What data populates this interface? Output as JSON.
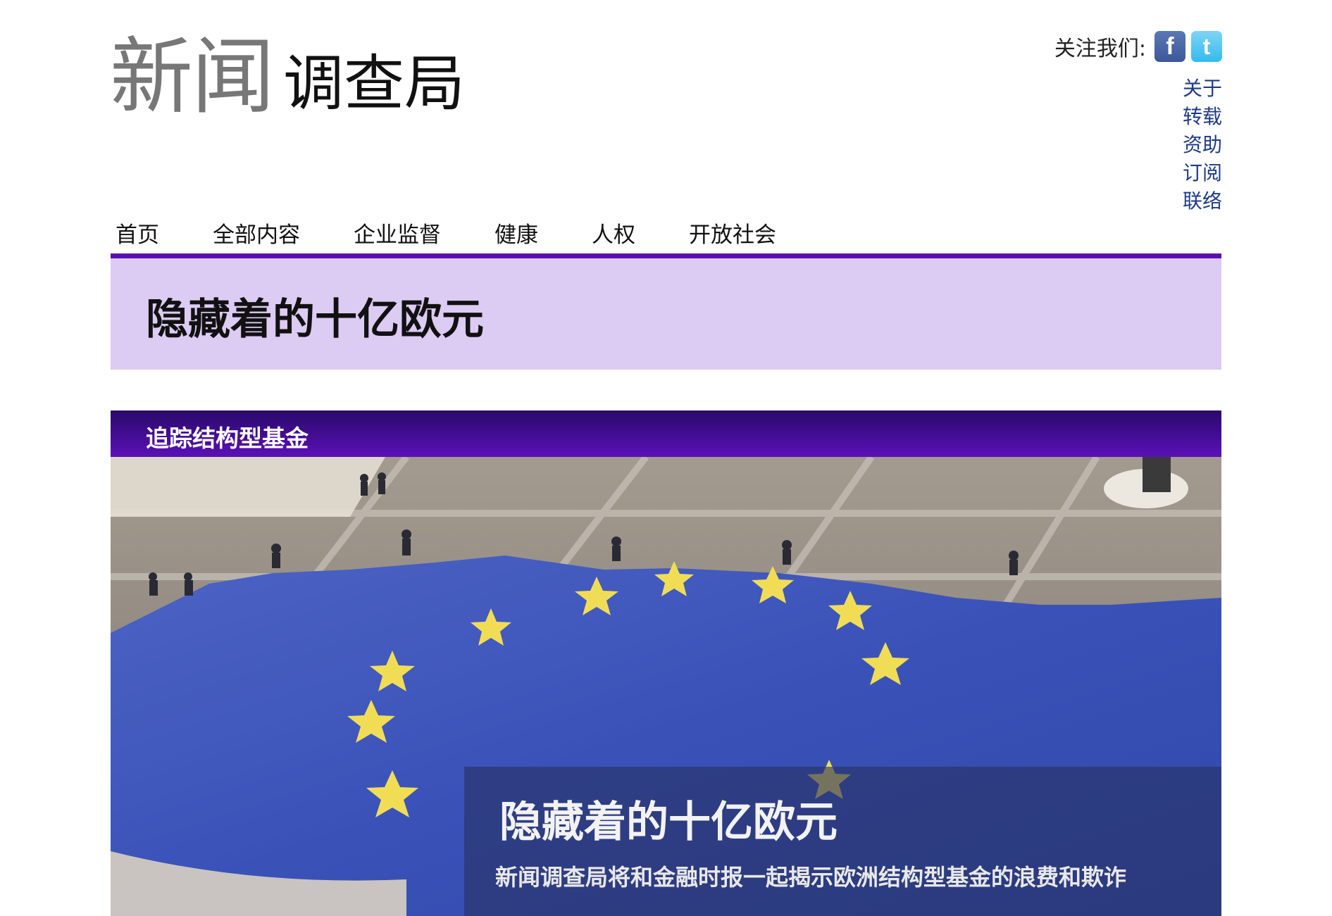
{
  "logo": {
    "part_a": "新闻",
    "part_b": "调查局"
  },
  "follow": {
    "label": "关注我们:",
    "facebook_icon": "facebook-icon",
    "twitter_icon": "twitter-icon",
    "facebook_glyph": "f",
    "twitter_glyph": "t"
  },
  "util_links": [
    "关于",
    "转载",
    "资助",
    "订阅",
    "联络"
  ],
  "nav": [
    "首页",
    "全部内容",
    "企业监督",
    "健康",
    "人权",
    "开放社会"
  ],
  "hero": {
    "title": "隐藏着的十亿欧元"
  },
  "section": {
    "title": "追踪结构型基金"
  },
  "feature": {
    "image": "eu-flag-photo",
    "title": "隐藏着的十亿欧元",
    "subtitle": "新闻调查局将和金融时报一起揭示欧洲结构型基金的浪费和欺诈"
  },
  "colors": {
    "accent": "#5a0fb0",
    "hero_bg": "#dccbf2",
    "link": "#1f3b88"
  }
}
